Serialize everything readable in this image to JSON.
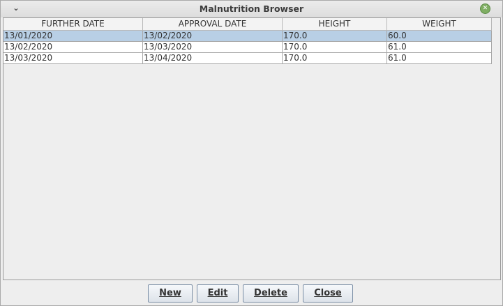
{
  "window": {
    "title": "Malnutrition Browser",
    "menu_icon": "chevron-down",
    "close_icon": "close"
  },
  "table": {
    "columns": [
      "FURTHER DATE",
      "APPROVAL DATE",
      "HEIGHT",
      "WEIGHT"
    ],
    "rows": [
      [
        "13/01/2020",
        "13/02/2020",
        "170.0",
        "60.0"
      ],
      [
        "13/02/2020",
        "13/03/2020",
        "170.0",
        "61.0"
      ],
      [
        "13/03/2020",
        "13/04/2020",
        "170.0",
        "61.0"
      ]
    ],
    "selected_row": 0
  },
  "buttons": {
    "new": "New",
    "edit": "Edit",
    "delete": "Delete",
    "close": "Close"
  },
  "colors": {
    "selection": "#b8cfe5",
    "close_icon": "#7fae63"
  }
}
